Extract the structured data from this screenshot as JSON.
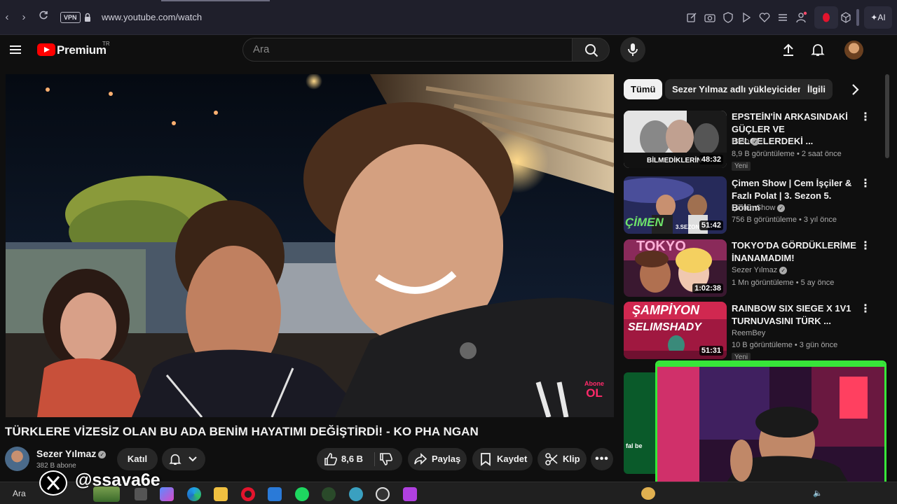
{
  "browser": {
    "url": "www.youtube.com/watch",
    "vpn_label": "VPN",
    "ai_label": "AI"
  },
  "header": {
    "logo_text": "Premium",
    "logo_badge": "TR",
    "search_placeholder": "Ara"
  },
  "video": {
    "overlay_line1": "Abone",
    "overlay_line2": "OL",
    "title": "TÜRKLERE VİZESİZ OLAN BU ADA BENİM HAYATIMI DEĞİŞTİRDİ! - KO PHA NGAN",
    "channel_name": "Sezer Yılmaz",
    "subscribers": "382 B abone",
    "join_label": "Katıl",
    "likes": "8,6 B",
    "share_label": "Paylaş",
    "save_label": "Kaydet",
    "clip_label": "Klip"
  },
  "chips": [
    "Tümü",
    "Sezer Yılmaz adlı yükleyiciden",
    "İlgili"
  ],
  "recommendations": [
    {
      "title": "EPSTEİN'İN ARKASINDAKİ GÜÇLER VE BELGELERDEKİ ...",
      "channel": "Baso",
      "meta": "8,9 B görüntüleme • 2 saat önce",
      "badge": "Yeni",
      "duration": "48:32",
      "thumb_text": "BİLMEDİKLERİN"
    },
    {
      "title": "Çimen Show | Cem İşçiler & Fazlı Polat | 3. Sezon 5. Bölüm",
      "channel": "Çimen Show",
      "meta": "756 B görüntüleme • 3 yıl önce",
      "duration": "51:42",
      "thumb_text": "ÇİMEN",
      "thumb_text2": "3.SEZON"
    },
    {
      "title": "TOKYO'DA GÖRDÜKLERİME İNANAMADIM!",
      "channel": "Sezer Yılmaz",
      "meta": "1 Mn görüntüleme • 5 ay önce",
      "duration": "1:02:38",
      "thumb_text": "TOKYO"
    },
    {
      "title": "RAINBOW SIX SIEGE X 1V1 TURNUVASINI TÜRK ...",
      "channel": "ReemBey",
      "meta": "10 B görüntüleme • 3 gün önce",
      "badge": "Yeni",
      "duration": "51:31",
      "thumb_text": "ŞAMPİYON",
      "thumb_text2": "SELIMSHADY"
    }
  ],
  "stream": {
    "watermark": "@ssava6e",
    "taskbar_search": "Ara",
    "partial_thumb_text": "fal be"
  },
  "colors": {
    "youtube_red": "#ff0000",
    "webcam_border": "#37e639",
    "background": "#0f0f0f"
  }
}
